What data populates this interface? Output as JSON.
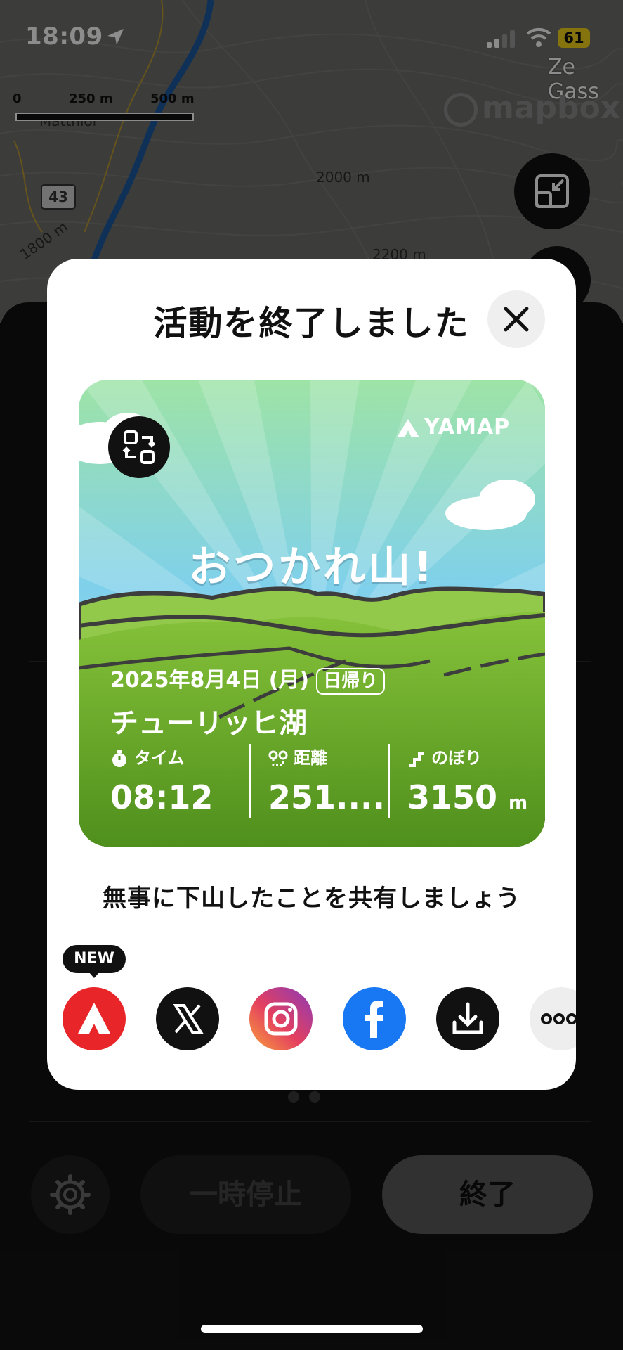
{
  "status_bar": {
    "time": "18:09",
    "battery": "61"
  },
  "map": {
    "town_label": "Ze Gass",
    "place_label": "Matthiol",
    "scale_labels": [
      "0",
      "250 m",
      "500 m"
    ],
    "attribution": "mapbox",
    "road_number": "43",
    "contour_labels": [
      "2000 m",
      "1800 m",
      "2200 m"
    ]
  },
  "sheet": {
    "pause_label": "一時停止",
    "end_label": "終了",
    "page_dots": 2
  },
  "modal": {
    "title": "活動を終了しました",
    "card": {
      "brand": "YAMAP",
      "headline": "おつかれ山!",
      "date": "2025年8月4日 (月)",
      "trip_type": "日帰り",
      "place": "チューリッヒ湖",
      "stats": [
        {
          "label": "タイム",
          "value": "08:12",
          "unit": ""
        },
        {
          "label": "距離",
          "value": "251....",
          "unit": ""
        },
        {
          "label": "のぼり",
          "value": "3150",
          "unit": "m"
        }
      ]
    },
    "share_prompt": "無事に下山したことを共有しましょう",
    "new_badge": "NEW",
    "share_targets": [
      {
        "name": "yamap",
        "color": "#e8262a"
      },
      {
        "name": "x",
        "color": "#111111"
      },
      {
        "name": "instagram",
        "color": "#d62976"
      },
      {
        "name": "facebook",
        "color": "#1877f2"
      },
      {
        "name": "download",
        "color": "#111111"
      },
      {
        "name": "more",
        "color": "#eeeeee"
      }
    ]
  }
}
